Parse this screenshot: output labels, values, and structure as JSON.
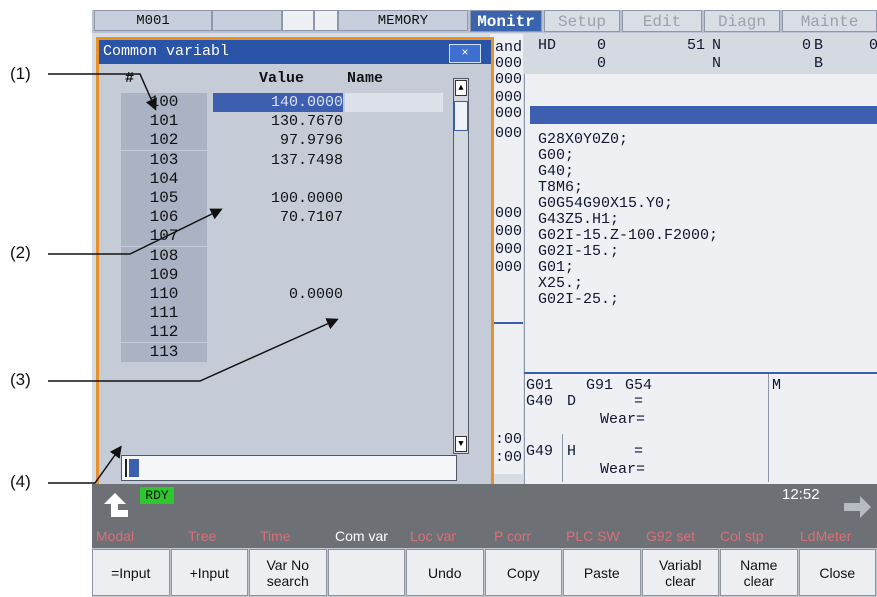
{
  "callouts": {
    "c1": "(1)",
    "c2": "(2)",
    "c3": "(3)",
    "c4": "(4)"
  },
  "topbar": {
    "program": "M001",
    "mode": "MEMORY",
    "tabs": [
      {
        "label": "Monitr",
        "active": true
      },
      {
        "label": "Setup",
        "active": false
      },
      {
        "label": "Edit",
        "active": false
      },
      {
        "label": "Diagn",
        "active": false
      },
      {
        "label": "Mainte",
        "active": false
      }
    ]
  },
  "monitor": {
    "hd": "HD",
    "row1": {
      "a": "0",
      "b": "51",
      "c": "N",
      "d": "0",
      "e": "B",
      "f": "0"
    },
    "row2": {
      "a": "0",
      "b": "N",
      "c": "B"
    },
    "peek_and": "and",
    "peek_values": [
      "000",
      "000",
      "000",
      "000",
      "000",
      "000",
      "000",
      "000",
      "000"
    ],
    "peek_times": [
      ":00",
      ":00"
    ],
    "program_lines": [
      "G28X0Y0Z0;",
      "G00;",
      "G40;",
      "T8M6;",
      "G0G54G90X15.Y0;",
      "G43Z5.H1;",
      "G02I-15.Z-100.F2000;",
      "G02I-15.;",
      "G01;",
      "X25.;",
      "G02I-25.;"
    ],
    "modal": {
      "g01": "G01",
      "g91": "G91",
      "g54": "G54",
      "m": "M",
      "g40": "G40",
      "d": "D",
      "eq": "=",
      "g49": "G49",
      "h": "H",
      "wear": "Wear="
    }
  },
  "popup": {
    "title": "Common variabl",
    "close": "×",
    "headers": {
      "num": "#",
      "value": "Value",
      "name": "Name"
    },
    "rows": [
      {
        "num": "100",
        "value": "140.0000",
        "selected": true
      },
      {
        "num": "101",
        "value": "130.7670"
      },
      {
        "num": "102",
        "value": "97.9796"
      },
      {
        "num": "103",
        "value": "137.7498"
      },
      {
        "num": "104",
        "value": ""
      },
      {
        "num": "105",
        "value": "100.0000"
      },
      {
        "num": "106",
        "value": "70.7107"
      },
      {
        "num": "107",
        "value": ""
      },
      {
        "num": "108",
        "value": ""
      },
      {
        "num": "109",
        "value": ""
      },
      {
        "num": "110",
        "value": "0.0000"
      },
      {
        "num": "111",
        "value": ""
      },
      {
        "num": "112",
        "value": ""
      },
      {
        "num": "113",
        "value": ""
      }
    ],
    "scroll_up": "▲",
    "scroll_down": "▼"
  },
  "status": {
    "rdy": "RDY",
    "time": "12:52"
  },
  "menu1": [
    {
      "label": "Modal",
      "active": false
    },
    {
      "label": "Tree",
      "active": false
    },
    {
      "label": "Time",
      "active": false
    },
    {
      "label": "Com var",
      "active": true
    },
    {
      "label": "Loc var",
      "active": false
    },
    {
      "label": "P corr",
      "active": false
    },
    {
      "label": "PLC SW",
      "active": false
    },
    {
      "label": "G92 set",
      "active": false
    },
    {
      "label": "Col stp",
      "active": false
    },
    {
      "label": "LdMeter",
      "active": false
    }
  ],
  "menu2": [
    "=Input",
    "+Input",
    "Var No\nsearch",
    "",
    "Undo",
    "Copy",
    "Paste",
    "Variabl\nclear",
    "Name\nclear",
    "Close"
  ],
  "colors": {
    "accent": "#2a54a8",
    "highlight_frame": "#e8902a",
    "menu_inactive": "#d8707a",
    "rdy": "#2ec82e"
  }
}
